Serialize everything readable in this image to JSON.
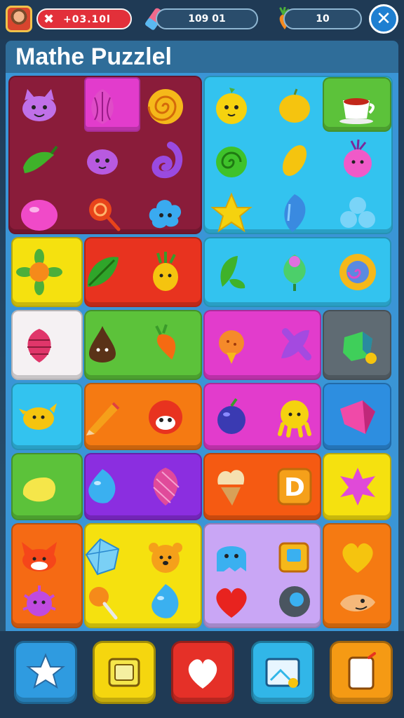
{
  "hud": {
    "health_value": "+03.10l",
    "health_icon": "x-mark-icon",
    "score_value": "109 01",
    "coins_value": "10",
    "close_icon": "close-icon"
  },
  "title": "Mathe Puzzlel",
  "colors": {
    "maroon": "#8a1c3a",
    "cyan": "#33c3ef",
    "yellow": "#f5e10f",
    "red": "#e8331f",
    "green": "#5cc23a",
    "magenta": "#e23ccc",
    "orange": "#f57a12",
    "purple": "#8b2ee0",
    "lavender": "#c9a6f5",
    "white": "#f5f1f3",
    "gray": "#5f6b73",
    "blue": "#2d8ee0"
  },
  "board": {
    "rows": 8,
    "cols": 6,
    "tiles": [
      [
        "cat-face",
        "pink-bulb",
        "swirl-candy",
        "yellow-chick",
        "lemon",
        "tea-cup"
      ],
      [
        "green-pepper",
        "purple-blob",
        "purple-curl",
        "green-swirl",
        "mango",
        "pink-radish"
      ],
      [
        "pink-gumdrop",
        "lollipop",
        "blue-cloud",
        "yellow-star",
        "blue-gem",
        "cyan-cluster"
      ],
      [
        "sunflower",
        "green-leaf",
        "pineapple",
        "leaf-sprig",
        "green-bulb",
        "sun-swirl"
      ],
      [
        "pink-berry",
        "choco-drop",
        "carrot",
        "orange-root",
        "purple-twist",
        "green-cube"
      ],
      [
        "yellow-bird",
        "pencil",
        "red-mushroom",
        "plum",
        "yellow-octopus",
        "pink-crystal"
      ],
      [
        "yellow-blob",
        "blue-drop",
        "pink-shell",
        "waffle-cone",
        "letter-d",
        "pink-splat"
      ],
      [
        "fox-face",
        "ice-crystal",
        "bear-face",
        "blue-ghost",
        "yellow-box",
        "heart"
      ]
    ]
  },
  "bottom_bar": {
    "buttons": [
      {
        "name": "star-button",
        "icon": "star-icon",
        "color": "#2f9be0"
      },
      {
        "name": "frame-button",
        "icon": "frame-icon",
        "color": "#f5d60f"
      },
      {
        "name": "heart-button",
        "icon": "heart-icon",
        "color": "#e53028"
      },
      {
        "name": "picture-button",
        "icon": "picture-icon",
        "color": "#31b6e8"
      },
      {
        "name": "card-button",
        "icon": "card-icon",
        "color": "#f59a14"
      }
    ]
  }
}
